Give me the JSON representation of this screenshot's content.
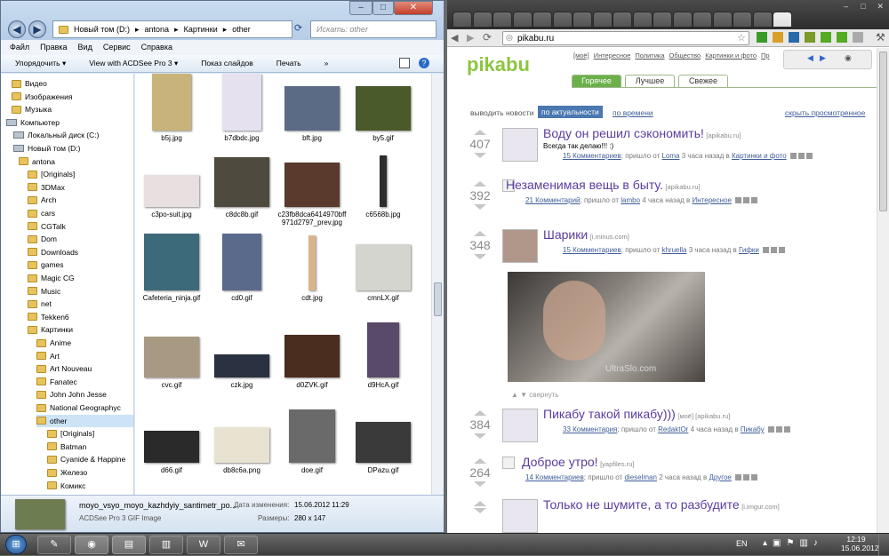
{
  "explorer": {
    "breadcrumb": [
      "Новый том (D:)",
      "antona",
      "Картинки",
      "other"
    ],
    "search_placeholder": "Искать: other",
    "menu": [
      "Файл",
      "Правка",
      "Вид",
      "Сервис",
      "Справка"
    ],
    "toolbar": [
      "Упорядочить ▾",
      "View with ACDSee Pro 3 ▾",
      "Показ слайдов",
      "Печать",
      "»"
    ],
    "tree": [
      {
        "label": "Видео",
        "kind": "lib"
      },
      {
        "label": "Изображения",
        "kind": "lib"
      },
      {
        "label": "Музыка",
        "kind": "lib"
      },
      {
        "label": "Компьютер",
        "kind": "comp"
      },
      {
        "label": "Локальный диск (C:)",
        "kind": "drive"
      },
      {
        "label": "Новый том (D:)",
        "kind": "drive"
      },
      {
        "label": "antona",
        "kind": "folder"
      },
      {
        "label": "[Originals]",
        "kind": "folder"
      },
      {
        "label": "3DMax",
        "kind": "folder"
      },
      {
        "label": "Arch",
        "kind": "folder"
      },
      {
        "label": "cars",
        "kind": "folder"
      },
      {
        "label": "CGTalk",
        "kind": "folder"
      },
      {
        "label": "Dom",
        "kind": "folder"
      },
      {
        "label": "Downloads",
        "kind": "folder"
      },
      {
        "label": "games",
        "kind": "folder"
      },
      {
        "label": "Magic CG",
        "kind": "folder"
      },
      {
        "label": "Music",
        "kind": "folder"
      },
      {
        "label": "net",
        "kind": "folder"
      },
      {
        "label": "Tekken6",
        "kind": "folder"
      },
      {
        "label": "Картинки",
        "kind": "folder"
      },
      {
        "label": "Anime",
        "kind": "folder"
      },
      {
        "label": "Art",
        "kind": "folder"
      },
      {
        "label": "Art Nouveau",
        "kind": "folder"
      },
      {
        "label": "Fanatec",
        "kind": "folder"
      },
      {
        "label": "John John Jesse",
        "kind": "folder"
      },
      {
        "label": "National Geographyc",
        "kind": "folder"
      },
      {
        "label": "other",
        "kind": "folder"
      },
      {
        "label": "[Originals]",
        "kind": "folder"
      },
      {
        "label": "Batman",
        "kind": "folder"
      },
      {
        "label": "Cyanide & Happine",
        "kind": "folder"
      },
      {
        "label": "Железо",
        "kind": "folder"
      },
      {
        "label": "Комикс",
        "kind": "folder"
      }
    ],
    "files": [
      {
        "name": "b5j.jpg",
        "color": "#c8b37a"
      },
      {
        "name": "b7dbdc.jpg",
        "color": "#e6e1ee"
      },
      {
        "name": "bft.jpg",
        "color": "#5b6a85"
      },
      {
        "name": "by5.gif",
        "color": "#4a5a2a"
      },
      {
        "name": "c3po-suit.jpg",
        "color": "#e8dfe0"
      },
      {
        "name": "c8dc8b.gif",
        "color": "#4e4a3e"
      },
      {
        "name": "c23fb8dca6414970bff971d2797_prev.jpg",
        "color": "#5a3a2d"
      },
      {
        "name": "c6568b.jpg",
        "color": "#2d2d2d"
      },
      {
        "name": "Cafeteria_ninja.gif",
        "color": "#3d6a7a"
      },
      {
        "name": "cd0.gif",
        "color": "#5a6a8a"
      },
      {
        "name": "cdt.jpg",
        "color": "#d9b48a"
      },
      {
        "name": "cmnLX.gif",
        "color": "#d5d5d0"
      },
      {
        "name": "cvc.gif",
        "color": "#a89a82"
      },
      {
        "name": "czk.jpg",
        "color": "#2a3140"
      },
      {
        "name": "d0ZVK.gif",
        "color": "#4a2d1e"
      },
      {
        "name": "d9HcA.gif",
        "color": "#5a4a6a"
      },
      {
        "name": "d66.gif",
        "color": "#2a2a2a"
      },
      {
        "name": "db8c6a.png",
        "color": "#e8e2d0"
      },
      {
        "name": "doe.gif",
        "color": "#6a6a6a"
      },
      {
        "name": "DPazu.gif",
        "color": "#3a3a3a"
      },
      {
        "name": "",
        "color": "#6a5aa8"
      },
      {
        "name": "",
        "color": "#3a2e22"
      },
      {
        "name": "",
        "color": "#6a3a1e"
      },
      {
        "name": "",
        "color": "#7a5a3a"
      }
    ],
    "details": {
      "filename": "moyo_vsyo_moyo_kazhdyiy_santimetr_po...",
      "type": "ACDSee Pro 3 GIF Image",
      "modified_label": "Дата изменения:",
      "modified_value": "15.06.2012 11:29",
      "size_label": "Размеры:",
      "size_value": "280 x 147"
    }
  },
  "browser": {
    "url": "pikabu.ru",
    "logo": "pikabu",
    "top_links": [
      "[моё]",
      "Интересное",
      "Политика",
      "Общество",
      "Картинки и фото",
      "Пр"
    ],
    "tabs": [
      "Горячее",
      "Лучшее",
      "Свежее"
    ],
    "sort": {
      "label": "выводить новости",
      "options": [
        "по актуальности",
        "по времени"
      ],
      "hide": "скрыть просмотренное"
    },
    "posts": [
      {
        "score": "407",
        "title": "Воду он решил сэкономить!",
        "source": "[apikabu.ru]",
        "subtitle": "Всегда так делаю!!! :)",
        "comments": "15 Комментариев",
        "author": "Loma",
        "time": "3 часа назад",
        "category": "Картинки и фото"
      },
      {
        "score": "392",
        "title": "Незаменимая вещь в быту.",
        "source": "[apikabu.ru]",
        "subtitle": "",
        "comments": "21 Комментарий",
        "author": "lambo",
        "time": "4 часа назад",
        "category": "Интересное"
      },
      {
        "score": "348",
        "title": "Шарики",
        "source": "[i.minus.com]",
        "subtitle": "",
        "comments": "15 Комментариев",
        "author": "khruella",
        "time": "3 часа назад",
        "category": "Гифки"
      },
      {
        "score": "384",
        "title": "Пикабу такой пикабу)))",
        "source": "[моё] [apikabu.ru]",
        "subtitle": "",
        "comments": "33 Комментария",
        "author": "RedaktOr",
        "time": "4 часа назад",
        "category": "Пикабу"
      },
      {
        "score": "264",
        "title": "Доброе утро!",
        "source": "[yapfiles.ru]",
        "subtitle": "",
        "comments": "14 Комментариев",
        "author": "dieselman",
        "time": "2 часа назад",
        "category": "Другое"
      },
      {
        "score": "",
        "title": "Только не шумите, а то разбудите",
        "source": "[i.imgur.com]",
        "subtitle": "",
        "comments": "",
        "author": "",
        "time": "",
        "category": ""
      }
    ],
    "meta_words": {
      "posted": "пришло от",
      "in": "в"
    },
    "collapse": "свернуть",
    "watermark": "UltraSlo.com"
  },
  "taskbar": {
    "lang": "EN",
    "time": "12:19",
    "date": "15.06.2012"
  }
}
